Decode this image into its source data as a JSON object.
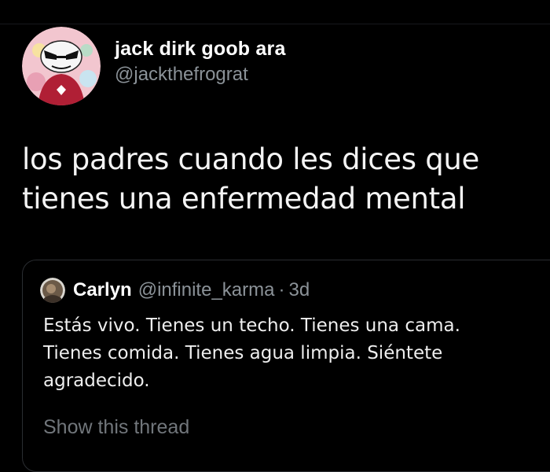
{
  "tweet": {
    "author": {
      "display_name": "jack dirk goob ara",
      "handle": "@jackthefrograt",
      "avatar_icon": "cartoon-character-avatar"
    },
    "text": "los padres cuando les dices que tienes una enfermedad mental"
  },
  "quoted_tweet": {
    "author": {
      "display_name": "Carlyn",
      "handle": "@infinite_karma",
      "avatar_icon": "photo-avatar"
    },
    "separator": "·",
    "time": "3d",
    "text": "Estás vivo. Tienes un techo. Tienes una cama. Tienes comida. Tienes agua limpia. Siéntete agradecido.",
    "show_thread_label": "Show this thread"
  },
  "colors": {
    "background": "#000000",
    "primary_text": "#ffffff",
    "secondary_text": "#8b9298",
    "border": "#2a2d31"
  }
}
